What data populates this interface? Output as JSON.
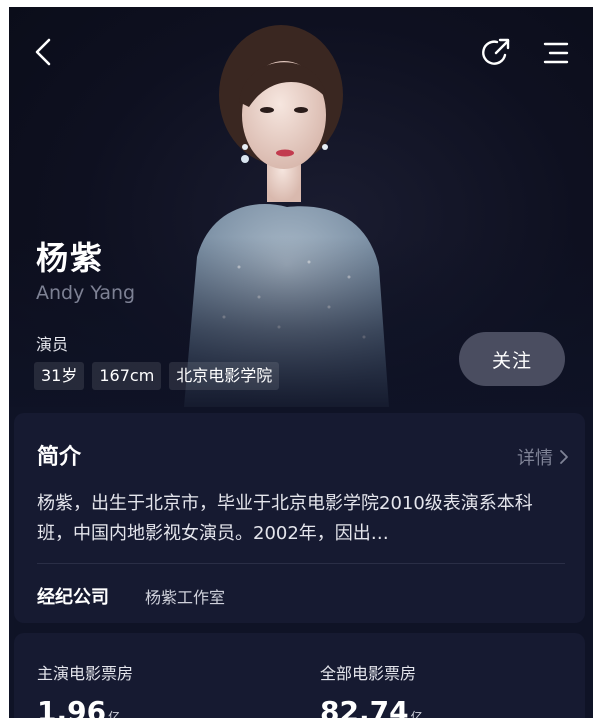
{
  "header": {
    "back_icon": "chevron-left-icon",
    "share_icon": "share-icon",
    "menu_icon": "menu-icon"
  },
  "profile": {
    "name": "杨紫",
    "english_name": "Andy Yang",
    "role": "演员",
    "tags": [
      "31岁",
      "167cm",
      "北京电影学院"
    ],
    "follow_label": "关注"
  },
  "intro": {
    "title": "简介",
    "detail_label": "详情",
    "bio": "杨紫，出生于北京市，毕业于北京电影学院2010级表演系本科班，中国内地影视女演员。2002年，因出…",
    "agency_label": "经纪公司",
    "agency_value": "杨紫工作室"
  },
  "box_office": {
    "lead_label": "主演电影票房",
    "lead_value": "1.96",
    "lead_unit": "亿",
    "total_label": "全部电影票房",
    "total_value": "82.74",
    "total_unit": "亿"
  },
  "colors": {
    "background": "#0f1326",
    "card": "#161a31",
    "follow_button": "#4a4d60"
  }
}
